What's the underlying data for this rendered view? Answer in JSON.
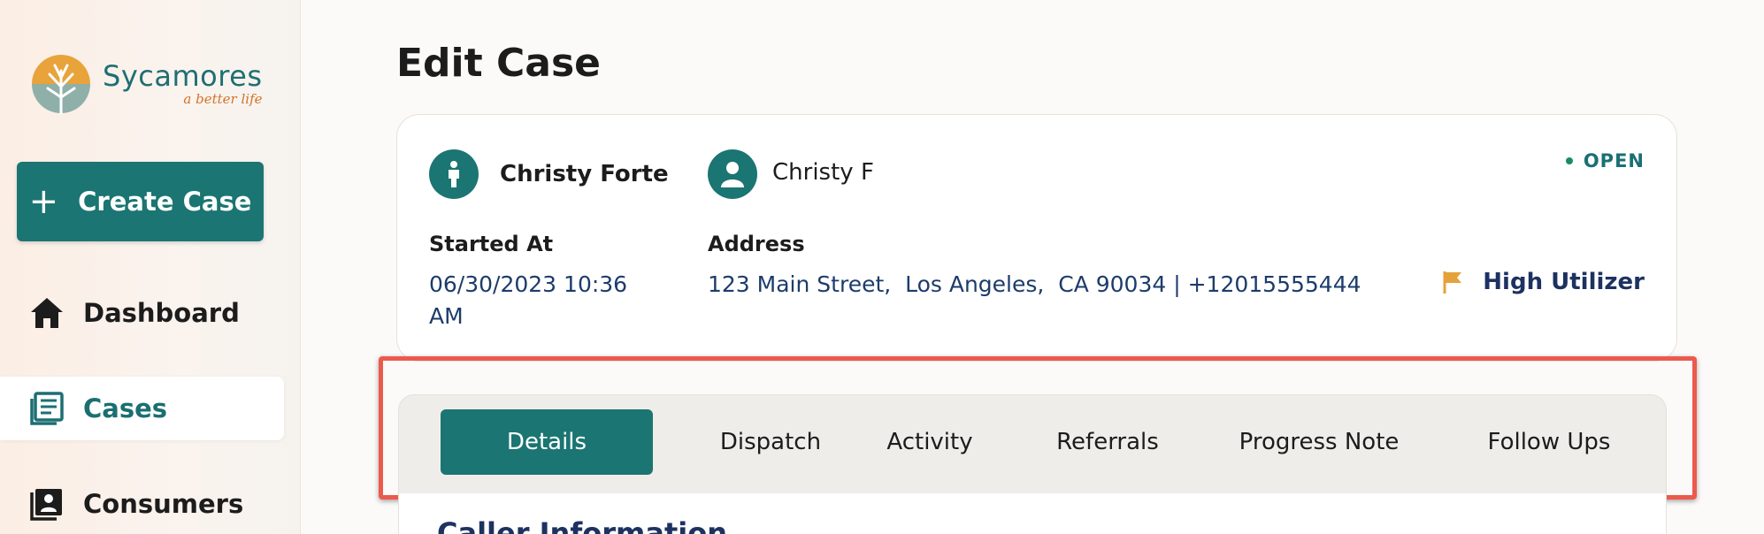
{
  "sidebar": {
    "logo": {
      "name": "Sycamores",
      "tagline": "a better life"
    },
    "create_button_label": "Create Case",
    "items": [
      {
        "label": "Dashboard",
        "icon": "home-icon",
        "active": false
      },
      {
        "label": "Cases",
        "icon": "cases-icon",
        "active": true
      },
      {
        "label": "Consumers",
        "icon": "consumers-icon",
        "active": false
      }
    ]
  },
  "page": {
    "title": "Edit Case"
  },
  "case": {
    "consumer_name": "Christy Forte",
    "caller_name": "Christy F",
    "status": "OPEN",
    "started_at_label": "Started At",
    "started_at_value": "06/30/2023 10:36 AM",
    "address_label": "Address",
    "address_value": "123 Main Street,  Los Angeles,  CA 90034 | +12015555444",
    "flag_label": "High Utilizer"
  },
  "tabs": [
    {
      "label": "Details",
      "active": true
    },
    {
      "label": "Dispatch",
      "active": false
    },
    {
      "label": "Activity",
      "active": false
    },
    {
      "label": "Referrals",
      "active": false
    },
    {
      "label": "Progress Note",
      "active": false
    },
    {
      "label": "Follow Ups",
      "active": false
    }
  ],
  "section": {
    "heading": "Caller Information"
  },
  "colors": {
    "brand": "#1b7572",
    "highlight": "#ec5a4d",
    "flag": "#e5a13a",
    "nav_text_active": "#1b6f73"
  }
}
